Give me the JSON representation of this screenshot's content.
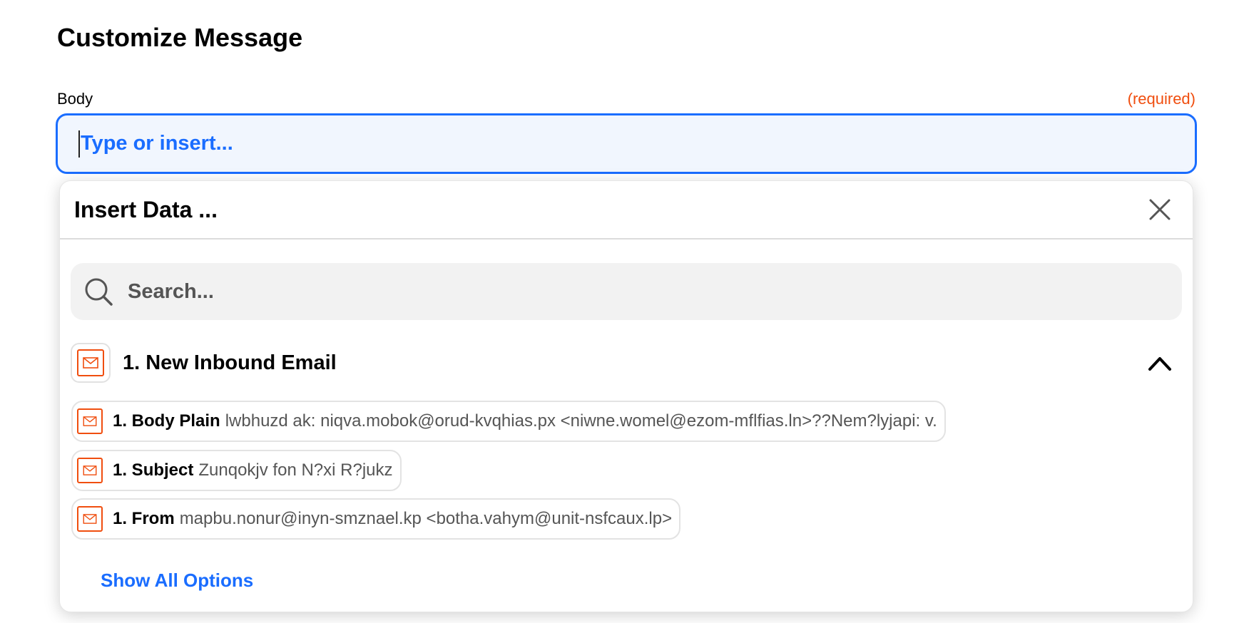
{
  "page_title": "Customize Message",
  "field": {
    "label": "Body",
    "required": "(required)",
    "placeholder": "Type or insert..."
  },
  "insert_panel": {
    "title": "Insert Data ...",
    "search_placeholder": "Search...",
    "group": {
      "title": "1. New Inbound Email",
      "icon": "mail-icon",
      "expanded": true
    },
    "items": [
      {
        "label": "1. Body Plain",
        "value": "lwbhuzd ak: niqva.mobok@orud-kvqhias.px <niwne.womel@ezom-mflfias.ln>??Nem?lyjapi: v."
      },
      {
        "label": "1. Subject",
        "value": "Zunqokjv fon N?xi R?jukz"
      },
      {
        "label": "1. From",
        "value": "mapbu.nonur@inyn-smznael.kp <botha.vahym@unit-nsfcaux.lp>"
      }
    ],
    "show_all": "Show All Options"
  },
  "colors": {
    "accent": "#1a6dff",
    "required": "#f04e0f",
    "app_icon": "#f04e0f"
  }
}
